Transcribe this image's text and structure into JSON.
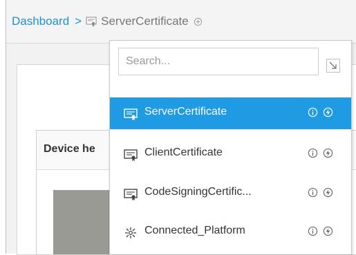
{
  "breadcrumb": {
    "root_label": "Dashboard",
    "separator": ">",
    "current_label": "ServerCertificate",
    "current_icon": "certificate-icon"
  },
  "background": {
    "panel_title": "Device he"
  },
  "dropdown": {
    "search": {
      "placeholder": "Search...",
      "value": ""
    },
    "expand_icon": "expand-arrow-icon",
    "items": [
      {
        "label": "ServerCertificate",
        "icon": "certificate-icon",
        "selected": true
      },
      {
        "label": "ClientCertificate",
        "icon": "certificate-icon",
        "selected": false
      },
      {
        "label": "CodeSigningCertific...",
        "icon": "certificate-icon",
        "selected": false
      },
      {
        "label": "Connected_Platform",
        "icon": "platform-icon",
        "selected": false
      }
    ]
  },
  "colors": {
    "accent": "#1e9be3",
    "link": "#1f8fd6",
    "text": "#333333",
    "muted": "#777777"
  }
}
